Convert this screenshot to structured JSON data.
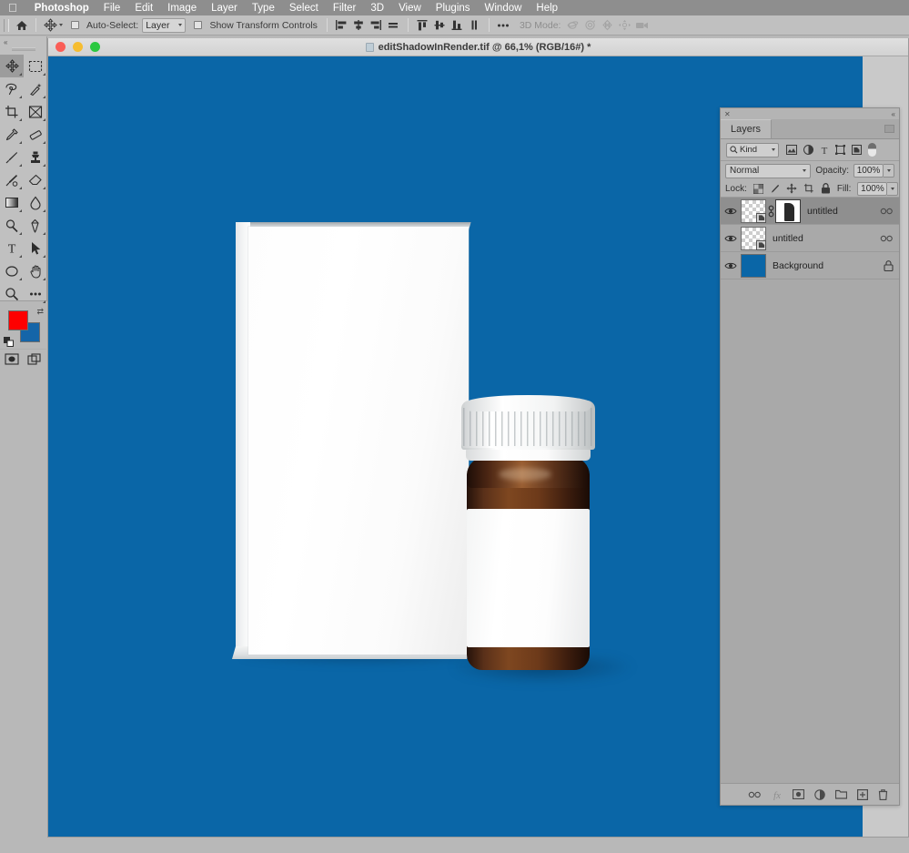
{
  "menubar": {
    "apple_icon": "apple-logo-icon",
    "items": [
      {
        "label": "Photoshop",
        "bold": true
      },
      {
        "label": "File",
        "bold": false
      },
      {
        "label": "Edit",
        "bold": false
      },
      {
        "label": "Image",
        "bold": false
      },
      {
        "label": "Layer",
        "bold": false
      },
      {
        "label": "Type",
        "bold": false
      },
      {
        "label": "Select",
        "bold": false
      },
      {
        "label": "Filter",
        "bold": false
      },
      {
        "label": "3D",
        "bold": false
      },
      {
        "label": "View",
        "bold": false
      },
      {
        "label": "Plugins",
        "bold": false
      },
      {
        "label": "Window",
        "bold": false
      },
      {
        "label": "Help",
        "bold": false
      }
    ]
  },
  "options_bar": {
    "home_icon": "home-icon",
    "tool_icon": "move-tool-icon",
    "auto_select_label": "Auto-Select:",
    "auto_select_value": "Layer",
    "show_transform_label": "Show Transform Controls",
    "align_icons": [
      "align-left-edges-icon",
      "align-horizontal-centers-icon",
      "align-right-edges-icon",
      "distribute-horizontal-icon"
    ],
    "align_icons_2": [
      "align-top-edges-icon",
      "align-vertical-centers-icon",
      "align-bottom-edges-icon",
      "distribute-vertical-icon"
    ],
    "more_icon": "ellipsis-icon",
    "mode_3d_label": "3D Mode:",
    "mode_3d_icons": [
      "3d-orbit-icon",
      "3d-roll-icon",
      "3d-pan-icon",
      "3d-slide-icon",
      "3d-camera-icon"
    ]
  },
  "toolbar": {
    "collapse_icon": "collapse-panel-icon",
    "tools": [
      {
        "name": "move-tool",
        "selected": true
      },
      {
        "name": "rectangular-marquee-tool",
        "selected": false
      },
      {
        "name": "lasso-tool",
        "selected": false
      },
      {
        "name": "magic-wand-tool",
        "selected": false
      },
      {
        "name": "crop-tool",
        "selected": false
      },
      {
        "name": "frame-tool",
        "selected": false
      },
      {
        "name": "eyedropper-tool",
        "selected": false
      },
      {
        "name": "spot-healing-brush-tool",
        "selected": false
      },
      {
        "name": "brush-tool",
        "selected": false
      },
      {
        "name": "clone-stamp-tool",
        "selected": false
      },
      {
        "name": "history-brush-tool",
        "selected": false
      },
      {
        "name": "eraser-tool",
        "selected": false
      },
      {
        "name": "gradient-tool",
        "selected": false
      },
      {
        "name": "blur-tool",
        "selected": false
      },
      {
        "name": "dodge-tool",
        "selected": false
      },
      {
        "name": "pen-tool",
        "selected": false
      },
      {
        "name": "horizontal-type-tool",
        "selected": false
      },
      {
        "name": "path-selection-tool",
        "selected": false
      },
      {
        "name": "ellipse-shape-tool",
        "selected": false
      },
      {
        "name": "hand-tool",
        "selected": false
      },
      {
        "name": "zoom-tool",
        "selected": false
      },
      {
        "name": "edit-toolbar-tool",
        "selected": false
      }
    ],
    "foreground_color": "#fe0000",
    "background_color": "#1565a8",
    "swap_colors_icon": "swap-colors-icon",
    "default_colors_icon": "default-colors-icon",
    "quick_mask_icon": "quick-mask-icon",
    "screen_mode_icon": "screen-mode-icon"
  },
  "document": {
    "title": "editShadowInRender.tif @ 66,1% (RGB/16#) *",
    "zoom": "66,1%",
    "color_mode": "RGB/16#",
    "filename": "editShadowInRender.tif",
    "modified": true,
    "traffic_lights": [
      "close-button",
      "minimize-button",
      "zoom-button"
    ]
  },
  "canvas": {
    "background_color": "#0a66a7",
    "objects": [
      {
        "name": "white-product-box",
        "type": "carton"
      },
      {
        "name": "amber-dropper-bottle",
        "type": "bottle",
        "cap": "white-ribbed-cap",
        "label": "white-blank-label"
      }
    ]
  },
  "layers_panel": {
    "close_icon": "close-icon",
    "collapse_icon": "collapse-to-icons-icon",
    "tab_label": "Layers",
    "menu_icon": "panel-menu-icon",
    "filter": {
      "search_icon": "search-icon",
      "kind_label": "Kind",
      "icons": [
        "pixel-layer-filter-icon",
        "adjustment-layer-filter-icon",
        "type-layer-filter-icon",
        "shape-layer-filter-icon",
        "smart-object-filter-icon"
      ],
      "toggle_name": "filter-enable-toggle"
    },
    "blend_mode": "Normal",
    "opacity_label": "Opacity:",
    "opacity_value": "100%",
    "lock_label": "Lock:",
    "lock_icons": [
      "lock-transparent-pixels-icon",
      "lock-image-pixels-icon",
      "lock-position-icon",
      "lock-artboard-nesting-icon",
      "lock-all-icon"
    ],
    "fill_label": "Fill:",
    "fill_value": "100%",
    "layers": [
      {
        "name": "untitled",
        "visible": true,
        "selected": true,
        "has_mask": true,
        "linked": true,
        "smart_object": true,
        "right_icon": "link-layers-icon",
        "thumbnail": "transparent-checker"
      },
      {
        "name": "untitled",
        "visible": true,
        "selected": false,
        "has_mask": false,
        "linked": false,
        "smart_object": true,
        "right_icon": "link-layers-icon",
        "thumbnail": "transparent-checker"
      },
      {
        "name": "Background",
        "visible": true,
        "selected": false,
        "has_mask": false,
        "linked": false,
        "smart_object": false,
        "right_icon": "lock-icon",
        "thumbnail": "solid-blue"
      }
    ],
    "footer_icons": [
      "link-layers-icon",
      "add-layer-style-icon",
      "add-layer-mask-icon",
      "new-adjustment-layer-icon",
      "new-group-icon",
      "new-layer-icon",
      "delete-layer-icon"
    ]
  }
}
